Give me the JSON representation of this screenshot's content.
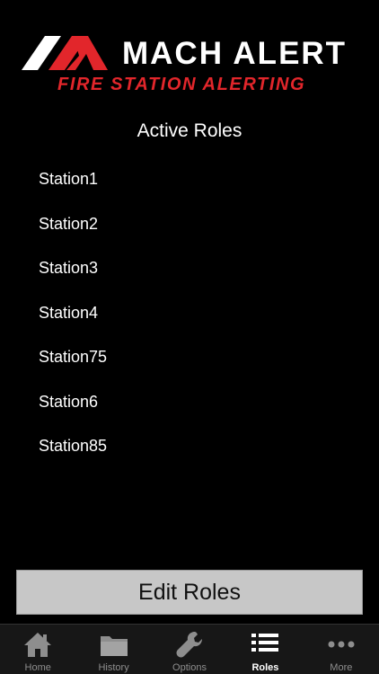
{
  "brand": {
    "title": "MACH ALERT",
    "tagline": "FIRE STATION ALERTING"
  },
  "header": {
    "title": "Active Roles"
  },
  "roles": [
    "Station1",
    "Station2",
    "Station3",
    "Station4",
    "Station75",
    "Station6",
    "Station85"
  ],
  "actions": {
    "edit_label": "Edit Roles"
  },
  "tabs": [
    {
      "label": "Home",
      "icon": "home-icon"
    },
    {
      "label": "History",
      "icon": "folder-icon"
    },
    {
      "label": "Options",
      "icon": "wrench-icon"
    },
    {
      "label": "Roles",
      "icon": "list-icon",
      "active": true
    },
    {
      "label": "More",
      "icon": "more-icon"
    }
  ],
  "colors": {
    "background": "#000000",
    "brand_red": "#e2262b",
    "button": "#c7c7c7",
    "tab_inactive": "#8e8e8e",
    "tab_active": "#ffffff"
  }
}
